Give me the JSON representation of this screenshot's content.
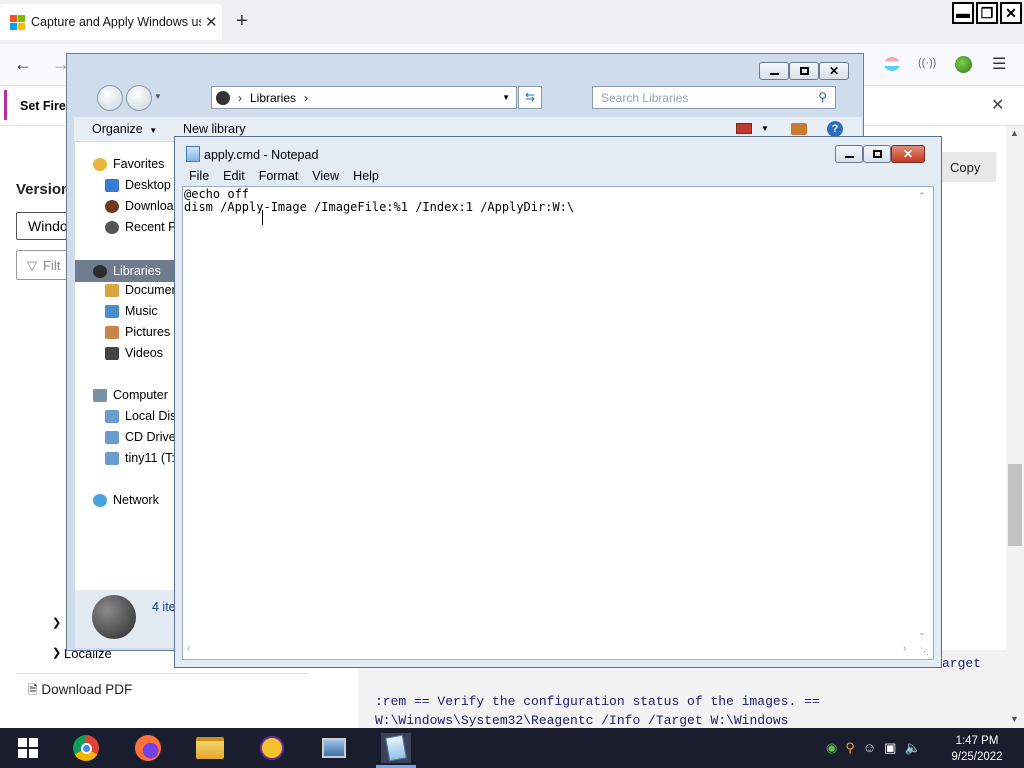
{
  "browser": {
    "tab_title": "Capture and Apply Windows us",
    "tab_close": "✕",
    "new_tab": "+",
    "notif_text": "Set Firef",
    "notif_close": "✕",
    "window_buttons": [
      "▬",
      "❐",
      "✕"
    ]
  },
  "webpage": {
    "version_heading": "Version",
    "select_value": "Windo",
    "filter_placeholder": "Filt",
    "copy_label": "Copy",
    "tree_item": "Localize",
    "download_pdf": "Download PDF",
    "code_fragment": "arget",
    "code_line1": ":rem == Verify the configuration status of the images. ==",
    "code_line2": "W:\\Windows\\System32\\Reagentc /Info /Target W:\\Windows"
  },
  "explorer": {
    "address_crumb": "Libraries",
    "search_placeholder": "Search Libraries",
    "organize_label": "Organize",
    "new_library_label": "New library",
    "favorites": {
      "header": "Favorites",
      "items": [
        "Desktop",
        "Downloa",
        "Recent Pl"
      ]
    },
    "libraries": {
      "header": "Libraries",
      "items": [
        "Documen",
        "Music",
        "Pictures",
        "Videos"
      ]
    },
    "computer": {
      "header": "Computer",
      "items": [
        "Local Disk",
        "CD Drive",
        "tiny11 (T:"
      ]
    },
    "network_label": "Network",
    "status_count": "4 ite"
  },
  "notepad": {
    "title": "apply.cmd - Notepad",
    "menu": [
      "File",
      "Edit",
      "Format",
      "View",
      "Help"
    ],
    "line1": "@echo off",
    "line2": "dism /Apply-Image /ImageFile:%1 /Index:1 /ApplyDir:W:\\"
  },
  "taskbar": {
    "time": "1:47 PM",
    "date": "9/25/2022"
  }
}
